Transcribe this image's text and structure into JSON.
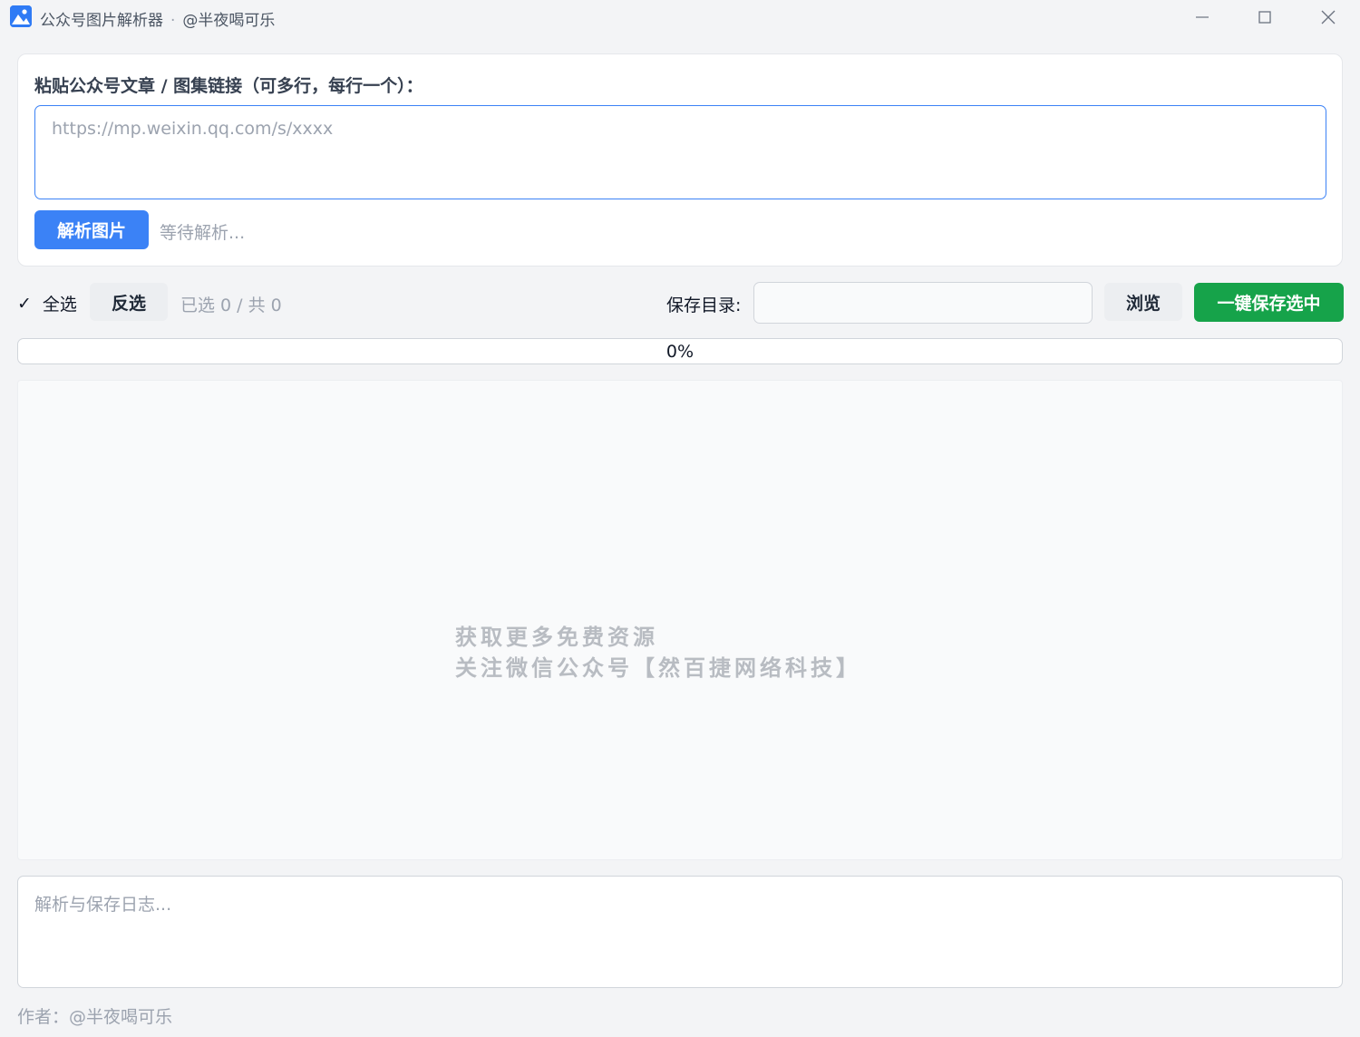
{
  "window": {
    "app_name": "公众号图片解析器",
    "separator": "·",
    "author_handle": "@半夜喝可乐",
    "icon": "image-icon",
    "controls": [
      "minimize-icon",
      "maximize-icon",
      "close-icon"
    ]
  },
  "input_card": {
    "label": "粘贴公众号文章 / 图集链接（可多行，每行一个）：",
    "url_value": "",
    "url_placeholder": "https://mp.weixin.qq.com/s/xxxx",
    "parse_button": "解析图片",
    "status": "等待解析..."
  },
  "toolbar": {
    "select_all_check": "✓",
    "select_all_label": "全选",
    "select_all_checked": true,
    "invert_button": "反选",
    "selection_count": "已选 0 / 共 0",
    "save_dir_label": "保存目录:",
    "save_dir_value": "",
    "browse_button": "浏览",
    "save_button": "一键保存选中"
  },
  "progress": {
    "percent": 0,
    "label": "0%"
  },
  "gallery": {
    "watermark_line1": "获取更多免费资源",
    "watermark_line2": "关注微信公众号【然百捷网络科技】"
  },
  "log": {
    "value": "",
    "placeholder": "解析与保存日志..."
  },
  "footer": {
    "author": "作者：@半夜喝可乐"
  },
  "colors": {
    "primary": "#3b82f6",
    "success": "#16a34a",
    "background": "#f3f4f6",
    "muted_text": "#9ca3af"
  }
}
